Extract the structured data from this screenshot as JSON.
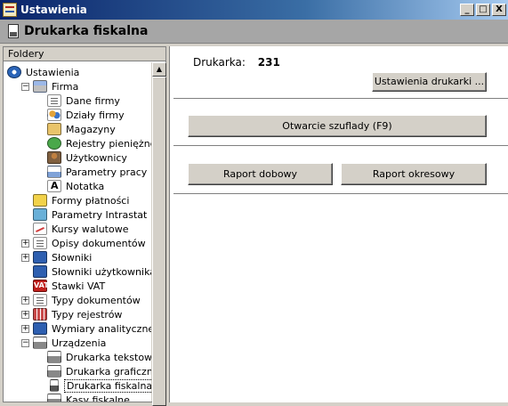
{
  "window": {
    "title": "Ustawienia",
    "minimize_glyph": "_",
    "maximize_glyph": "□",
    "close_glyph": "X"
  },
  "header": {
    "title": "Drukarka fiskalna",
    "icon": "fiscal-printer-icon"
  },
  "folders_panel": {
    "title": "Foldery",
    "tree": [
      {
        "label": "Ustawienia",
        "depth": 0,
        "expander": "",
        "icon": "gear-icon"
      },
      {
        "label": "Firma",
        "depth": 1,
        "expander": "−",
        "icon": "building-icon"
      },
      {
        "label": "Dane firmy",
        "depth": 2,
        "expander": "",
        "icon": "document-icon"
      },
      {
        "label": "Działy firmy",
        "depth": 2,
        "expander": "",
        "icon": "people-icon"
      },
      {
        "label": "Magazyny",
        "depth": 2,
        "expander": "",
        "icon": "warehouse-icon"
      },
      {
        "label": "Rejestry pieniężne",
        "depth": 2,
        "expander": "",
        "icon": "money-icon"
      },
      {
        "label": "Użytkownicy",
        "depth": 2,
        "expander": "",
        "icon": "users-icon"
      },
      {
        "label": "Parametry pracy",
        "depth": 2,
        "expander": "",
        "icon": "settings-sheet-icon"
      },
      {
        "label": "Notatka",
        "depth": 2,
        "expander": "",
        "icon": "note-icon"
      },
      {
        "label": "Formy płatności",
        "depth": 1,
        "expander": "",
        "icon": "payment-icon"
      },
      {
        "label": "Parametry Intrastat",
        "depth": 1,
        "expander": "",
        "icon": "network-icon"
      },
      {
        "label": "Kursy walutowe",
        "depth": 1,
        "expander": "",
        "icon": "chart-icon"
      },
      {
        "label": "Opisy dokumentów",
        "depth": 1,
        "expander": "+",
        "icon": "description-icon"
      },
      {
        "label": "Słowniki",
        "depth": 1,
        "expander": "+",
        "icon": "dictionary-icon"
      },
      {
        "label": "Słowniki użytkownika",
        "depth": 1,
        "expander": "",
        "icon": "user-dictionary-icon"
      },
      {
        "label": "Stawki VAT",
        "depth": 1,
        "expander": "",
        "icon": "vat-icon"
      },
      {
        "label": "Typy dokumentów",
        "depth": 1,
        "expander": "+",
        "icon": "document-types-icon"
      },
      {
        "label": "Typy rejestrów",
        "depth": 1,
        "expander": "+",
        "icon": "register-grid-icon"
      },
      {
        "label": "Wymiary analityczne",
        "depth": 1,
        "expander": "+",
        "icon": "dimensions-icon"
      },
      {
        "label": "Urządzenia",
        "depth": 1,
        "expander": "−",
        "icon": "devices-printer-icon"
      },
      {
        "label": "Drukarka tekstowa",
        "depth": 2,
        "expander": "",
        "icon": "printer-icon"
      },
      {
        "label": "Drukarka graficzna",
        "depth": 2,
        "expander": "",
        "icon": "printer-icon"
      },
      {
        "label": "Drukarka fiskalna",
        "depth": 2,
        "expander": "",
        "icon": "fiscal-printer-icon",
        "selected": true
      },
      {
        "label": "Kasy fiskalne",
        "depth": 2,
        "expander": "",
        "icon": "cash-register-icon"
      }
    ],
    "scroll_up_glyph": "▲"
  },
  "main": {
    "printer_label": "Drukarka:",
    "printer_value": "231",
    "printer_settings_button": "Ustawienia drukarki ...",
    "open_drawer_button": "Otwarcie szuflady (F9)",
    "daily_report_button": "Raport dobowy",
    "periodic_report_button": "Raport okresowy"
  },
  "colors": {
    "title_bar": "#0a246a",
    "header_bar": "#a6a6a6",
    "face": "#d4d0c8",
    "content_bg": "#ffffff"
  }
}
